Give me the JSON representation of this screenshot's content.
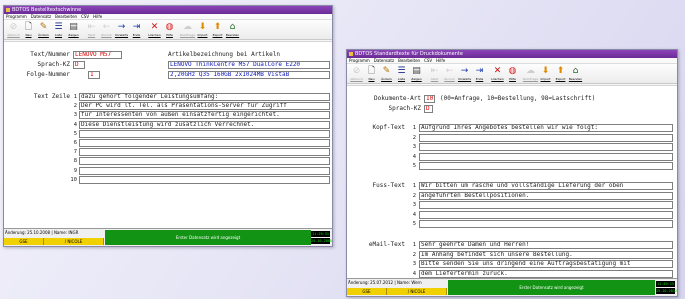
{
  "toolbar_items": [
    {
      "label": "Abbruch",
      "glyph": "⊘",
      "color": "#777777",
      "disabled": true
    },
    {
      "label": "Neu",
      "glyph": "🗋",
      "color": "#333333",
      "disabled": false
    },
    {
      "label": "Ändern",
      "glyph": "✎",
      "color": "#b07000",
      "disabled": false
    },
    {
      "label": "Liste",
      "glyph": "☰",
      "color": "#1a2a88",
      "disabled": false
    },
    {
      "label": "Zeigen",
      "glyph": "▤",
      "color": "#444444",
      "disabled": false
    },
    {
      "label": "Start",
      "glyph": "⇤",
      "color": "#888888",
      "disabled": true
    },
    {
      "label": "Zurück",
      "glyph": "←",
      "color": "#888888",
      "disabled": true
    },
    {
      "label": "Vorwärts",
      "glyph": "→",
      "color": "#1a3aa8",
      "disabled": false
    },
    {
      "label": "Ende",
      "glyph": "⇥",
      "color": "#1a3aa8",
      "disabled": false
    },
    {
      "label": "Löschen",
      "glyph": "✕",
      "color": "#cc1111",
      "disabled": false
    },
    {
      "label": "Hilfe",
      "glyph": "◍",
      "color": "#dd2222",
      "disabled": false
    },
    {
      "label": "Rückfrage",
      "glyph": "☁",
      "color": "#888888",
      "disabled": true
    },
    {
      "label": "Import",
      "glyph": "⬇",
      "color": "#e08a00",
      "disabled": false
    },
    {
      "label": "Export",
      "glyph": "⬆",
      "color": "#e08a00",
      "disabled": false
    },
    {
      "label": "Beenden",
      "glyph": "⌂",
      "color": "#2a6a2a",
      "disabled": false
    }
  ],
  "colors": {
    "accent": "#7a34a8",
    "field_red": "#d40000",
    "field_blue": "#0d18b8",
    "status_green": "#139313",
    "status_yellow": "#f1d000"
  },
  "w1": {
    "title": "BDTOS Bestelltextschwinne",
    "menu": [
      "Programm",
      "Datensatz",
      "Bearbeiten",
      "CSV",
      "Hilfe"
    ],
    "text_nummer_label": "Text/Nummer",
    "text_nummer_value": "LENOVO M57",
    "sprach_kz_label": "Sprach-KZ",
    "sprach_kz_value": "D",
    "folge_nummer_label": "Folge-Nummer",
    "folge_nummer_value": "1",
    "artikel_heading": "Artikelbezeichnung bei Artikeln",
    "artikel_line1": "LENOVO ThinkCentre M57 DualCore E220",
    "artikel_line2": "2,20GHz Q35 160GB 2x1024MB VistaB",
    "text_zeile_label": "Text Zeile",
    "lines": [
      {
        "n": "1",
        "t": "dazu gehört folgender Leistungsumfang:"
      },
      {
        "n": "2",
        "t": "Der PC wird lt. Tel. als Präsentations-Server für Zugriff"
      },
      {
        "n": "3",
        "t": "für Interessenten von außen einsatzfertig eingerichtet."
      },
      {
        "n": "4",
        "t": "Diese Dienstleistung wird zusätzlich Verrechnet."
      },
      {
        "n": "5",
        "t": ""
      },
      {
        "n": "6",
        "t": ""
      },
      {
        "n": "7",
        "t": ""
      },
      {
        "n": "8",
        "t": ""
      },
      {
        "n": "9",
        "t": ""
      },
      {
        "n": "10",
        "t": ""
      }
    ],
    "status": {
      "aenderung": "Änderung: 25.10.2008",
      "name": "Name: INGR",
      "user1": "GSE",
      "user2": "/ NICOLE",
      "message": "Erster Datensatz wird angezeigt",
      "clock1": "11:29:31",
      "clock2": "25.10.2008"
    }
  },
  "w2": {
    "title": "BDTOS Standardtexte für Druckdokumente",
    "menu": [
      "Programm",
      "Datensatz",
      "Bearbeiten",
      "CSV",
      "Hilfe"
    ],
    "dokumente_art_label": "Dokumente-Art",
    "dokumente_art_value": "10",
    "dokumente_art_hint": "(00=Anfrage, 10=Bestellung, 98=Lastschrift)",
    "sprach_kz_label": "Sprach-KZ",
    "sprach_kz_value": "D",
    "kopf": {
      "label": "Kopf-Text",
      "lines": [
        {
          "n": "1",
          "t": "Aufgrund Ihres Angebotes bestellen wir wie folgt:"
        },
        {
          "n": "2",
          "t": ""
        },
        {
          "n": "3",
          "t": ""
        },
        {
          "n": "4",
          "t": ""
        },
        {
          "n": "5",
          "t": ""
        }
      ]
    },
    "fuss": {
      "label": "Fuss-Text",
      "lines": [
        {
          "n": "1",
          "t": "Wir bitten um rasche und vollständige Lieferung der oben"
        },
        {
          "n": "2",
          "t": "angeführten Bestellpositionen."
        },
        {
          "n": "3",
          "t": ""
        },
        {
          "n": "4",
          "t": ""
        },
        {
          "n": "5",
          "t": ""
        }
      ]
    },
    "email": {
      "label": "eMail-Text",
      "lines": [
        {
          "n": "1",
          "t": "Sehr geehrte Damen und Herren!"
        },
        {
          "n": "2",
          "t": "Im Anhang befindet sich unsere Bestellung."
        },
        {
          "n": "3",
          "t": "Bitte senden Sie uns dringend eine Auftragsbestätigung mit"
        },
        {
          "n": "4",
          "t": "dem Liefertermin zurück."
        }
      ]
    },
    "status": {
      "aenderung": "Änderung: 25.07.2012",
      "name": "Name: Wern",
      "user1": "GSE",
      "user2": "/ NICOLE",
      "message": "Erster Datensatz wird angezeigt",
      "clock1": "11:49:15",
      "clock2": "25.10.2012"
    }
  }
}
